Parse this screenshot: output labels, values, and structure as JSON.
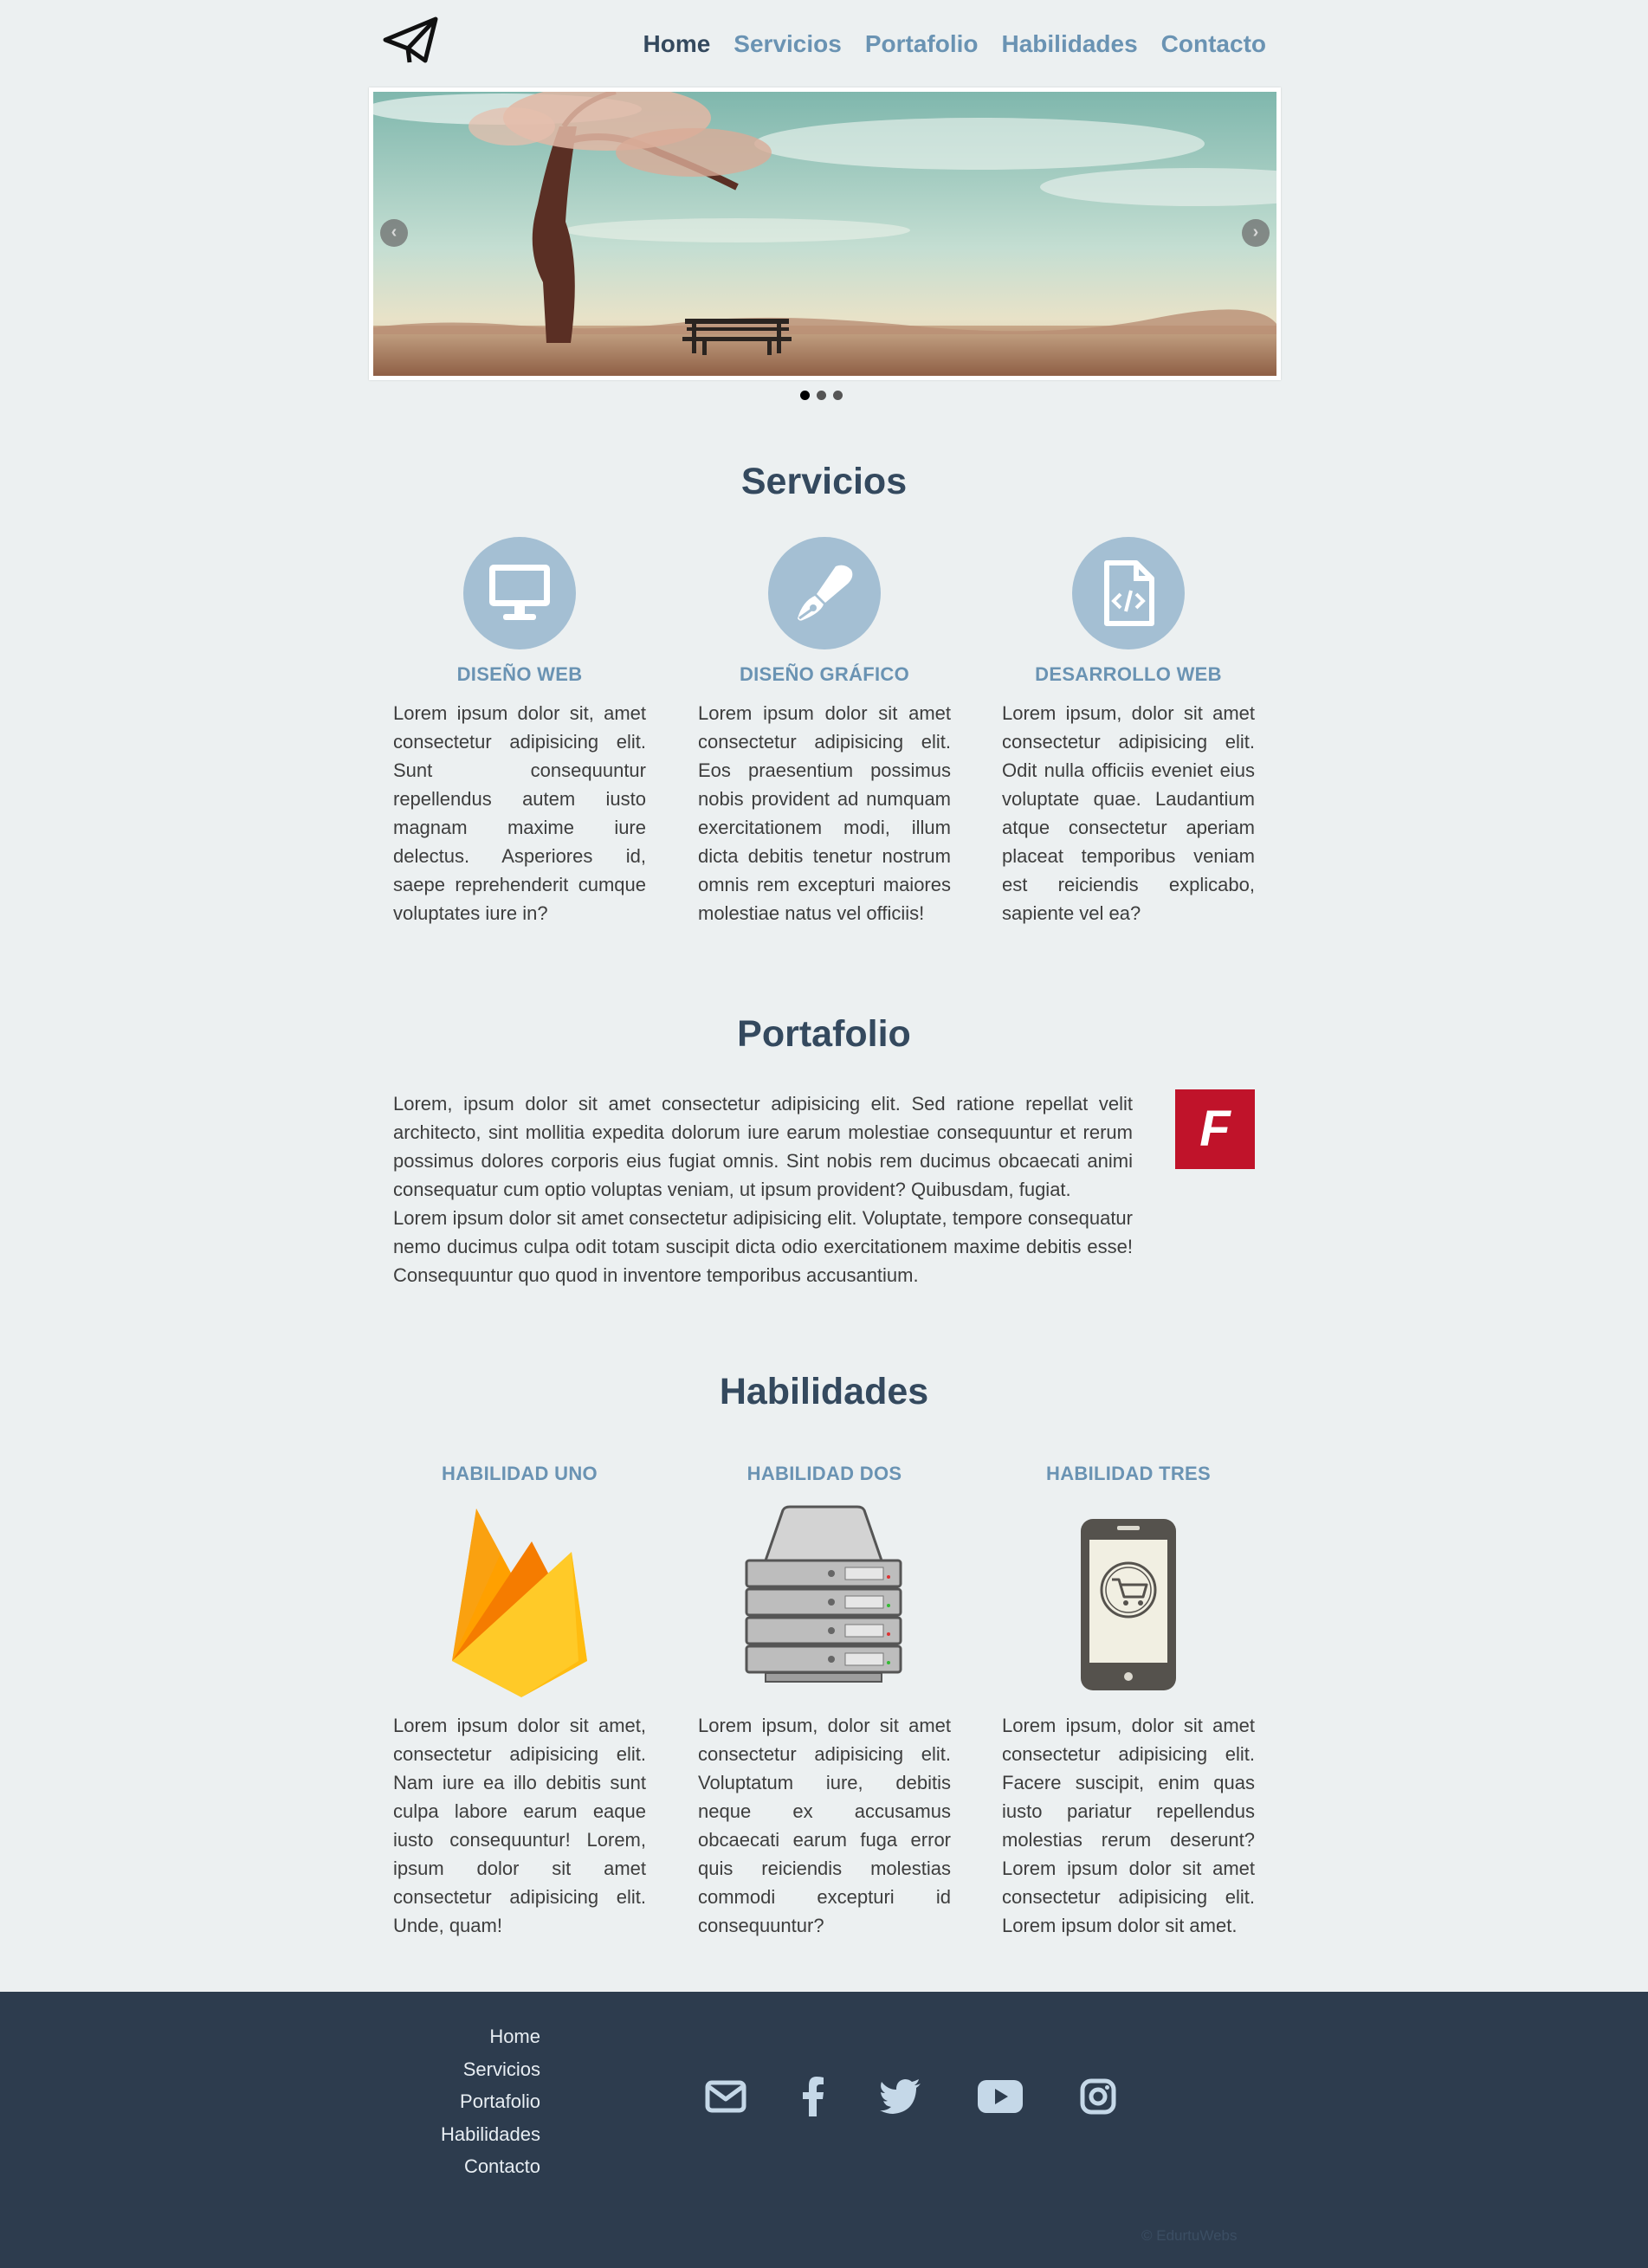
{
  "nav": {
    "logo_icon": "paper-plane-icon",
    "items": [
      "Home",
      "Servicios",
      "Portafolio",
      "Habilidades",
      "Contacto"
    ],
    "active": "Home"
  },
  "slider": {
    "prev_label": "‹",
    "next_label": "›",
    "slide_count": 3,
    "active_slide": 1
  },
  "services": {
    "title": "Servicios",
    "items": [
      {
        "icon": "monitor-icon",
        "title": "DISEÑO WEB",
        "text": "Lorem ipsum dolor sit, amet consectetur adipisicing elit. Sunt consequuntur repellendus autem iusto magnam maxime iure delectus. Asperiores id, saepe reprehenderit cumque voluptates iure in?"
      },
      {
        "icon": "pen-nib-icon",
        "title": "DISEÑO GRÁFICO",
        "text": "Lorem ipsum dolor sit amet consectetur adipisicing elit. Eos praesentium possimus nobis provident ad numquam exercitationem modi, illum dicta debitis tenetur nostrum omnis rem excepturi maiores molestiae natus vel officiis!"
      },
      {
        "icon": "file-code-icon",
        "title": "DESARROLLO WEB",
        "text": "Lorem ipsum, dolor sit amet consectetur adipisicing elit. Odit nulla officiis eveniet eius voluptate quae. Laudantium atque consectetur aperiam placeat temporibus veniam est reiciendis explicabo, sapiente vel ea?"
      }
    ]
  },
  "portfolio": {
    "title": "Portafolio",
    "paragraph1": "Lorem, ipsum dolor sit amet consectetur adipisicing elit. Sed ratione repellat velit architecto, sint mollitia expedita dolorum iure earum molestiae consequuntur et rerum possimus dolores corporis eius fugiat omnis. Sint nobis rem ducimus obcaecati animi consequatur cum optio voluptas veniam, ut ipsum provident? Quibusdam, fugiat.",
    "paragraph2": "Lorem ipsum dolor sit amet consectetur adipisicing elit. Voluptate, tempore consequatur nemo ducimus culpa odit totam suscipit dicta odio exercitationem maxime debitis esse! Consequuntur quo quod in inventore temporibus accusantium.",
    "badge_letter": "F",
    "badge_color": "#c0132a"
  },
  "skills": {
    "title": "Habilidades",
    "items": [
      {
        "icon": "firebase-icon",
        "title": "HABILIDAD UNO",
        "text": "Lorem ipsum dolor sit amet, consectetur adipisicing elit. Nam iure ea illo debitis sunt culpa labore earum eaque iusto consequuntur! Lorem, ipsum dolor sit amet consectetur adipisicing elit. Unde, quam!"
      },
      {
        "icon": "server-icon",
        "title": "HABILIDAD DOS",
        "text": "Lorem ipsum, dolor sit amet consectetur adipisicing elit. Voluptatum iure, debitis neque ex accusamus obcaecati earum fuga error quis reiciendis molestias commodi excepturi id consequuntur?"
      },
      {
        "icon": "mobile-shopping-icon",
        "title": "HABILIDAD TRES",
        "text": "Lorem ipsum, dolor sit amet consectetur adipisicing elit. Facere suscipit, enim quas iusto pariatur repellendus molestias rerum deserunt? Lorem ipsum dolor sit amet consectetur adipisicing elit. Lorem ipsum dolor sit amet."
      }
    ]
  },
  "footer": {
    "links": [
      "Home",
      "Servicios",
      "Portafolio",
      "Habilidades",
      "Contacto"
    ],
    "social_icons": [
      "envelope-icon",
      "facebook-icon",
      "twitter-icon",
      "youtube-icon",
      "instagram-icon"
    ],
    "copyright": "© EdurtuWebs"
  },
  "colors": {
    "background": "#ecf0f1",
    "heading": "#34495e",
    "accent": "#6a93b3",
    "icon_circle": "#a4bfd3",
    "footer": "#2d3c4e"
  }
}
